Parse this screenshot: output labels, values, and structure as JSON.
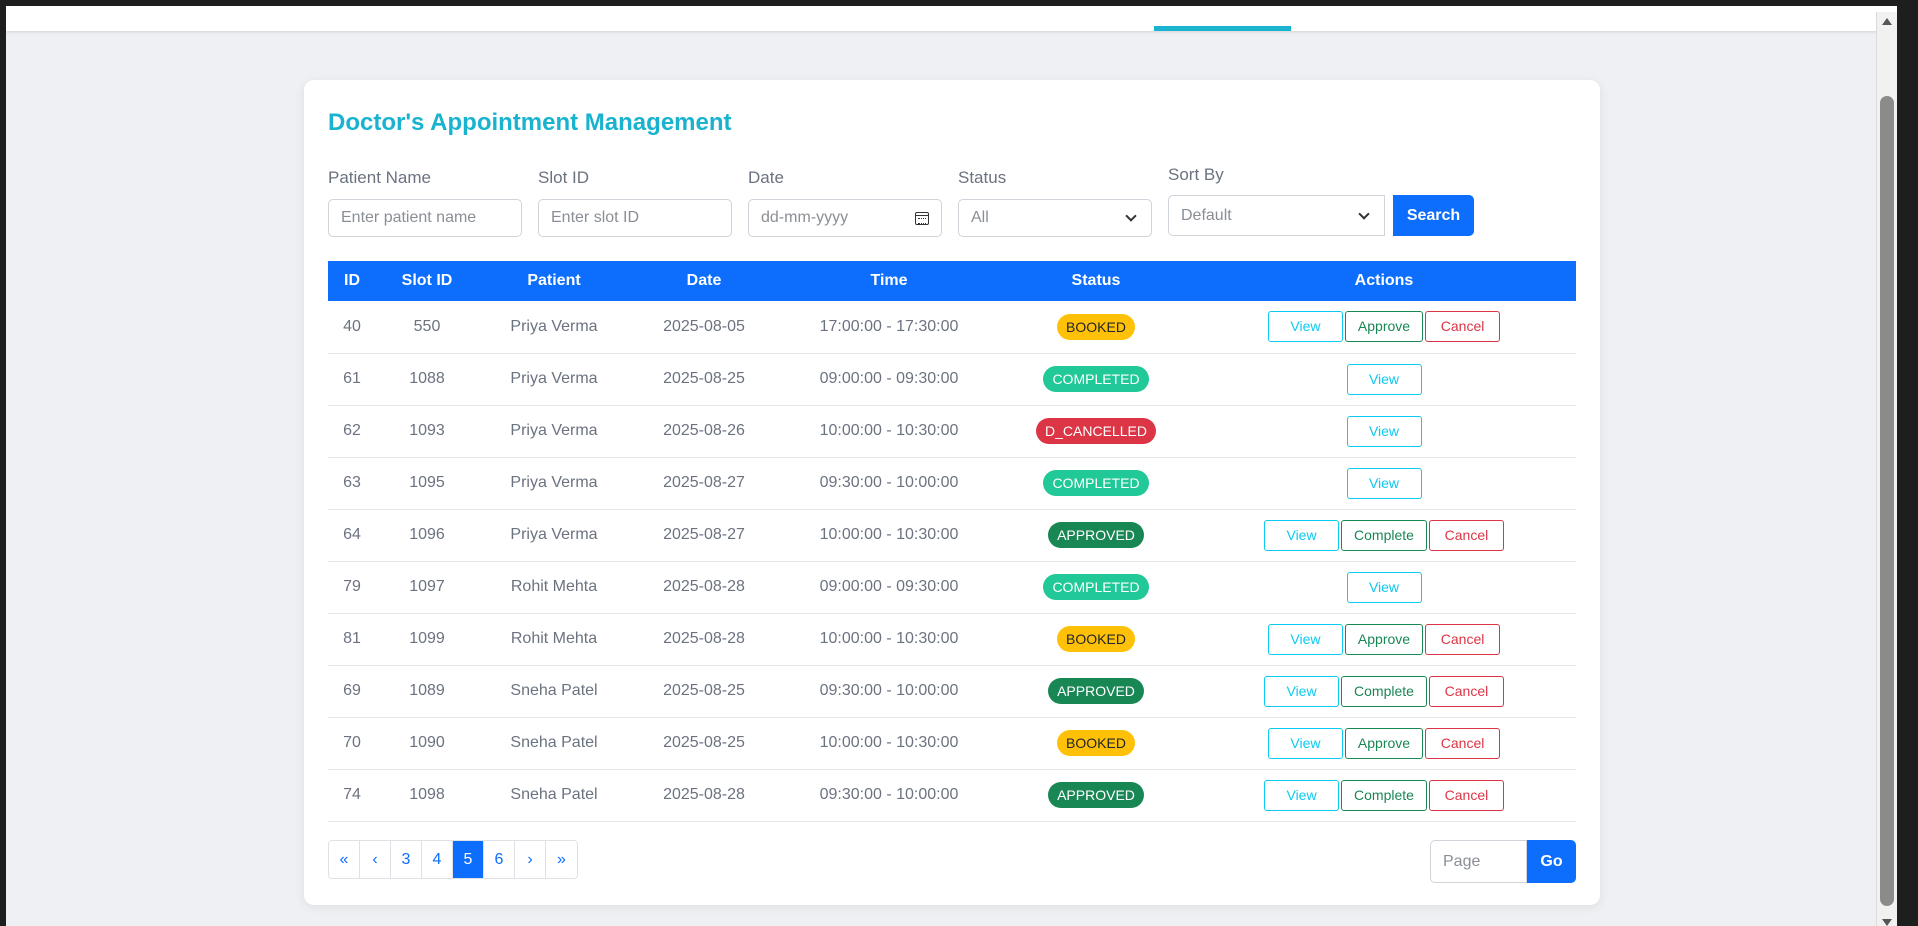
{
  "title": "Doctor's Appointment Management",
  "filters": {
    "patient_name": {
      "label": "Patient Name",
      "placeholder": "Enter patient name"
    },
    "slot_id": {
      "label": "Slot ID",
      "placeholder": "Enter slot ID"
    },
    "date": {
      "label": "Date",
      "placeholder": "dd-mm-yyyy"
    },
    "status": {
      "label": "Status",
      "value": "All"
    },
    "sort_by": {
      "label": "Sort By",
      "value": "Default"
    },
    "search_label": "Search"
  },
  "table": {
    "headers": [
      "ID",
      "Slot ID",
      "Patient",
      "Date",
      "Time",
      "Status",
      "Actions"
    ],
    "rows": [
      {
        "id": "40",
        "slot": "550",
        "patient": "Priya Verma",
        "date": "2025-08-05",
        "time": "17:00:00 - 17:30:00",
        "status": "BOOKED",
        "actions": [
          "View",
          "Approve",
          "Cancel"
        ]
      },
      {
        "id": "61",
        "slot": "1088",
        "patient": "Priya Verma",
        "date": "2025-08-25",
        "time": "09:00:00 - 09:30:00",
        "status": "COMPLETED",
        "actions": [
          "View"
        ]
      },
      {
        "id": "62",
        "slot": "1093",
        "patient": "Priya Verma",
        "date": "2025-08-26",
        "time": "10:00:00 - 10:30:00",
        "status": "D_CANCELLED",
        "actions": [
          "View"
        ]
      },
      {
        "id": "63",
        "slot": "1095",
        "patient": "Priya Verma",
        "date": "2025-08-27",
        "time": "09:30:00 - 10:00:00",
        "status": "COMPLETED",
        "actions": [
          "View"
        ]
      },
      {
        "id": "64",
        "slot": "1096",
        "patient": "Priya Verma",
        "date": "2025-08-27",
        "time": "10:00:00 - 10:30:00",
        "status": "APPROVED",
        "actions": [
          "View",
          "Complete",
          "Cancel"
        ]
      },
      {
        "id": "79",
        "slot": "1097",
        "patient": "Rohit Mehta",
        "date": "2025-08-28",
        "time": "09:00:00 - 09:30:00",
        "status": "COMPLETED",
        "actions": [
          "View"
        ]
      },
      {
        "id": "81",
        "slot": "1099",
        "patient": "Rohit Mehta",
        "date": "2025-08-28",
        "time": "10:00:00 - 10:30:00",
        "status": "BOOKED",
        "actions": [
          "View",
          "Approve",
          "Cancel"
        ]
      },
      {
        "id": "69",
        "slot": "1089",
        "patient": "Sneha Patel",
        "date": "2025-08-25",
        "time": "09:30:00 - 10:00:00",
        "status": "APPROVED",
        "actions": [
          "View",
          "Complete",
          "Cancel"
        ]
      },
      {
        "id": "70",
        "slot": "1090",
        "patient": "Sneha Patel",
        "date": "2025-08-25",
        "time": "10:00:00 - 10:30:00",
        "status": "BOOKED",
        "actions": [
          "View",
          "Approve",
          "Cancel"
        ]
      },
      {
        "id": "74",
        "slot": "1098",
        "patient": "Sneha Patel",
        "date": "2025-08-28",
        "time": "09:30:00 - 10:00:00",
        "status": "APPROVED",
        "actions": [
          "View",
          "Complete",
          "Cancel"
        ]
      }
    ]
  },
  "pagination": {
    "items": [
      "«",
      "‹",
      "3",
      "4",
      "5",
      "6",
      "›",
      "»"
    ],
    "current": "5",
    "goto_placeholder": "Page",
    "go_label": "Go"
  },
  "colors": {
    "accent": "#1ab3cf",
    "primary": "#0d6efd",
    "booked": "#ffc107",
    "completed": "#20c997",
    "cancelled": "#dc3545",
    "approved": "#198754"
  }
}
